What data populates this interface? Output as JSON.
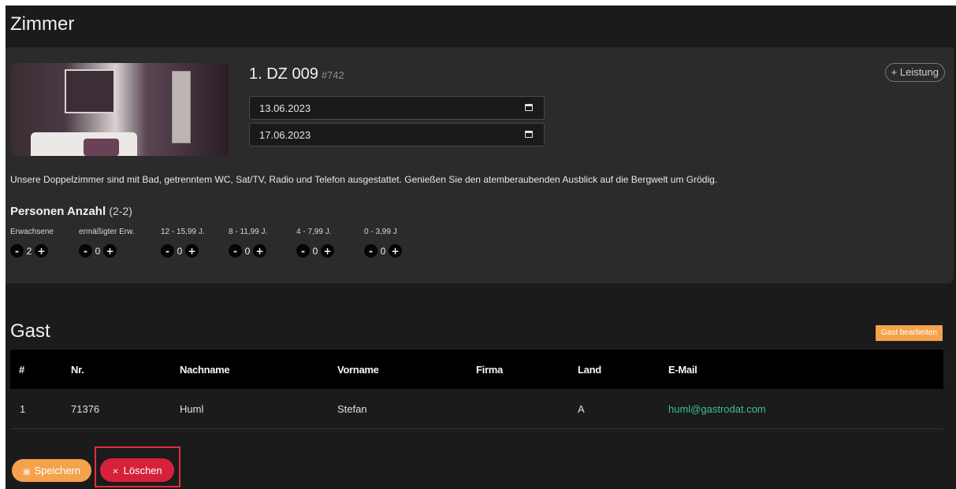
{
  "page": {
    "title": "Zimmer"
  },
  "room": {
    "title": "1. DZ 009",
    "number": "#742",
    "date_from": "13.06.2023",
    "date_to": "17.06.2023",
    "add_service_label": "+ Leistung",
    "description": "Unsere Doppelzimmer sind mit Bad, getrenntem WC, Sat/TV, Radio und Telefon ausgestattet. Genießen Sie den atemberaubenden Ausblick auf die Bergwelt um Grödig.",
    "persons_title": "Personen Anzahl",
    "persons_range": "(2-2)",
    "age_groups": [
      {
        "label": "Erwachsene",
        "value": "2"
      },
      {
        "label": "ermäßigter Erw.",
        "value": "0"
      },
      {
        "label": "12 - 15,99 J.",
        "value": "0"
      },
      {
        "label": "8 - 11,99 J.",
        "value": "0"
      },
      {
        "label": "4 - 7,99 J.",
        "value": "0"
      },
      {
        "label": "0 - 3,99 J",
        "value": "0"
      }
    ],
    "minus": "-",
    "plus": "+"
  },
  "guest": {
    "title": "Gast",
    "edit_label": "Gast bearbeiten",
    "columns": [
      "#",
      "Nr.",
      "Nachname",
      "Vorname",
      "Firma",
      "Land",
      "E-Mail"
    ],
    "rows": [
      {
        "idx": "1",
        "nr": "71376",
        "lastname": "Huml",
        "firstname": "Stefan",
        "company": "",
        "country": "A",
        "email": "huml@gastrodat.com"
      }
    ]
  },
  "actions": {
    "save_label": "Speichern",
    "delete_label": "Löschen",
    "save_icon": "floppy-icon",
    "delete_icon": "close-icon"
  },
  "colors": {
    "accent": "#f4a34c",
    "danger": "#d7213a",
    "email": "#3cc08a",
    "background": "#1b1b1b",
    "card": "#2b2b2b"
  }
}
